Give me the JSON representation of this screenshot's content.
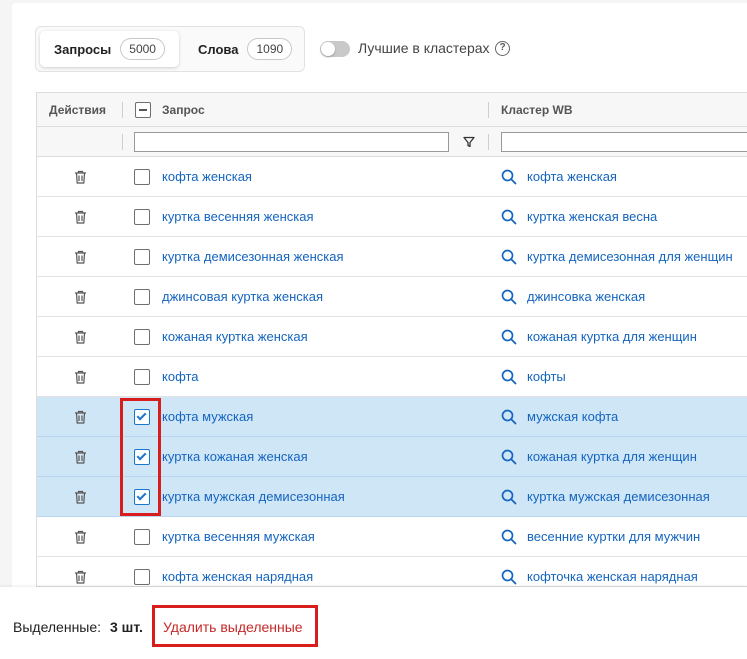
{
  "tabs": [
    {
      "label": "Запросы",
      "count": "5000"
    },
    {
      "label": "Слова",
      "count": "1090"
    }
  ],
  "toggle": {
    "label": "Лучшие в кластерах",
    "help": "?"
  },
  "table": {
    "columns": {
      "actions": "Действия",
      "query": "Запрос",
      "cluster": "Кластер WB"
    },
    "filter_icon": "filter-icon",
    "rows": [
      {
        "query": "кофта женская",
        "cluster": "кофта женская",
        "checked": false
      },
      {
        "query": "куртка весенняя женская",
        "cluster": "куртка женская весна",
        "checked": false
      },
      {
        "query": "куртка демисезонная женская",
        "cluster": "куртка демисезонная для женщин",
        "checked": false
      },
      {
        "query": "джинсовая куртка женская",
        "cluster": "джинсовка женская",
        "checked": false
      },
      {
        "query": "кожаная куртка женская",
        "cluster": "кожаная куртка для женщин",
        "checked": false
      },
      {
        "query": "кофта",
        "cluster": "кофты",
        "checked": false
      },
      {
        "query": "кофта мужская",
        "cluster": "мужская кофта",
        "checked": true
      },
      {
        "query": "куртка кожаная женская",
        "cluster": "кожаная куртка для женщин",
        "checked": true
      },
      {
        "query": "куртка мужская демисезонная",
        "cluster": "куртка мужская демисезонная",
        "checked": true
      },
      {
        "query": "куртка весенняя мужская",
        "cluster": "весенние куртки для мужчин",
        "checked": false
      },
      {
        "query": "кофта женская нарядная",
        "cluster": "кофточка женская нарядная",
        "checked": false
      }
    ]
  },
  "footer": {
    "selected_label": "Выделенные:",
    "selected_count": "3 шт.",
    "delete_label": "Удалить выделенные"
  },
  "colors": {
    "link": "#1565c0",
    "selected_row": "#cfe6f7",
    "danger": "#c62828",
    "highlight": "#d91c1c"
  }
}
